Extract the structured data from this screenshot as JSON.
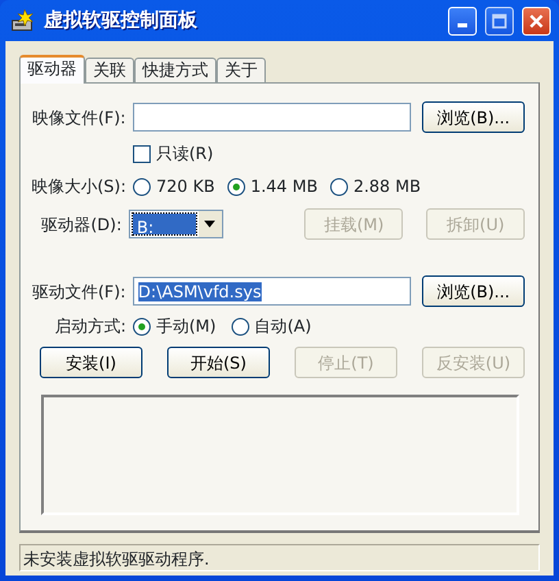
{
  "window": {
    "title": "虚拟软驱控制面板"
  },
  "tabs": [
    {
      "label": "驱动器",
      "selected": true
    },
    {
      "label": "关联",
      "selected": false
    },
    {
      "label": "快捷方式",
      "selected": false
    },
    {
      "label": "关于",
      "selected": false
    }
  ],
  "image_file": {
    "label": "映像文件(F):",
    "browse": "浏览(B)..."
  },
  "readonly": {
    "label": "只读(R)",
    "checked": false
  },
  "image_size": {
    "label": "映像大小(S):",
    "options": [
      {
        "label": "720 KB",
        "selected": false
      },
      {
        "label": "1.44 MB",
        "selected": true
      },
      {
        "label": "2.88 MB",
        "selected": false
      }
    ]
  },
  "drive": {
    "label": "驱动器(D):",
    "value": "B:",
    "mount": {
      "label": "挂载(M)",
      "disabled": true
    },
    "unmount": {
      "label": "拆卸(U)",
      "disabled": true
    }
  },
  "driver_file": {
    "label": "驱动文件(F):",
    "value": "D:\\ASM\\vfd.sys",
    "browse": "浏览(B)..."
  },
  "start_mode": {
    "label": "启动方式:",
    "options": [
      {
        "label": "手动(M)",
        "selected": true
      },
      {
        "label": "自动(A)",
        "selected": false
      }
    ]
  },
  "actions": [
    {
      "label": "安装(I)",
      "disabled": false
    },
    {
      "label": "开始(S)",
      "disabled": false
    },
    {
      "label": "停止(T)",
      "disabled": true
    },
    {
      "label": "反安装(U)",
      "disabled": true
    }
  ],
  "status_bar": "未安装虚拟软驱驱动程序."
}
